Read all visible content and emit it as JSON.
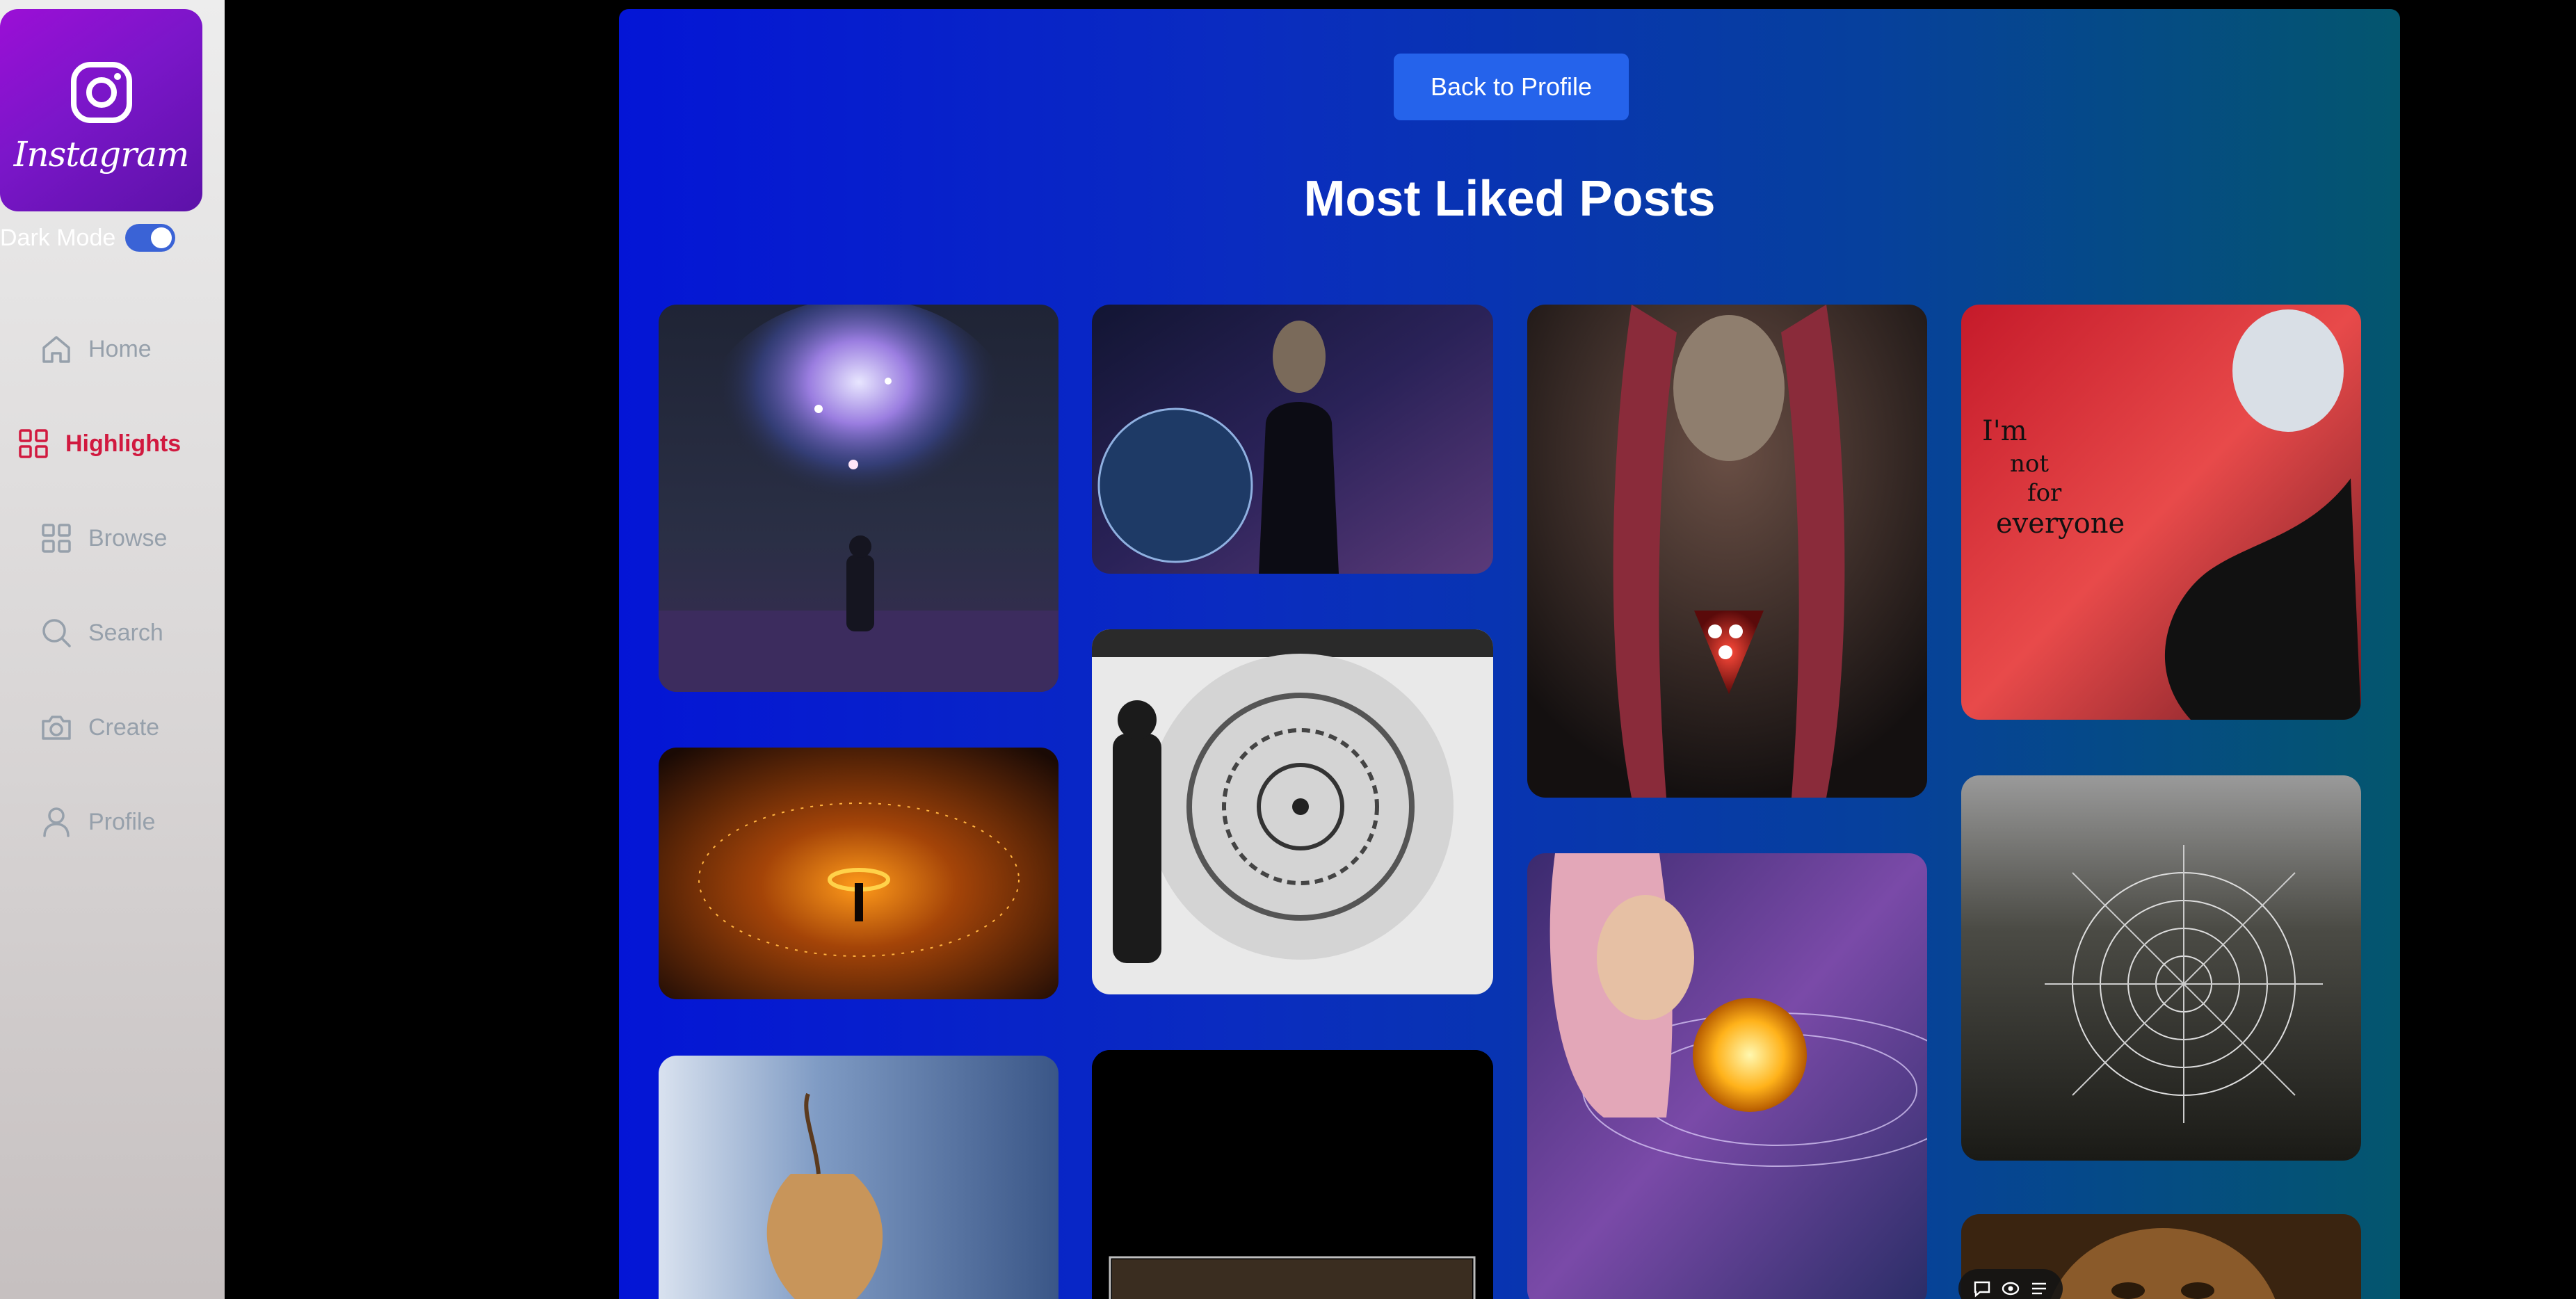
{
  "app": {
    "logo_text": "Instagram",
    "dark_mode_label": "Dark Mode",
    "dark_mode_on": true
  },
  "nav": {
    "items": [
      {
        "label": "Home",
        "icon": "home-icon",
        "active": false
      },
      {
        "label": "Highlights",
        "icon": "grid-icon",
        "active": true
      },
      {
        "label": "Browse",
        "icon": "grid-icon",
        "active": false
      },
      {
        "label": "Search",
        "icon": "search-icon",
        "active": false
      },
      {
        "label": "Create",
        "icon": "camera-icon",
        "active": false
      },
      {
        "label": "Profile",
        "icon": "user-icon",
        "active": false
      }
    ]
  },
  "page": {
    "back_button_label": "Back to Profile",
    "title": "Most Liked Posts"
  },
  "posts": [
    {
      "subject": "cosmic-nebula-figure"
    },
    {
      "subject": "steel-wool-fire-ring"
    },
    {
      "subject": "frosted-physalis"
    },
    {
      "subject": "astronaut-planet"
    },
    {
      "subject": "mandala-wall-art"
    },
    {
      "subject": "dark-video"
    },
    {
      "subject": "heart-lights-portrait"
    },
    {
      "subject": "solar-system-woman"
    },
    {
      "subject": "im-not-for-everyone",
      "caption_lines": [
        "I'm",
        "not",
        "for",
        "everyone"
      ]
    },
    {
      "subject": "spider-web"
    },
    {
      "subject": "portrait-eyes"
    }
  ],
  "colors": {
    "accent_active": "#d1193f",
    "button": "#2563eb",
    "toggle": "#3a63d6"
  }
}
